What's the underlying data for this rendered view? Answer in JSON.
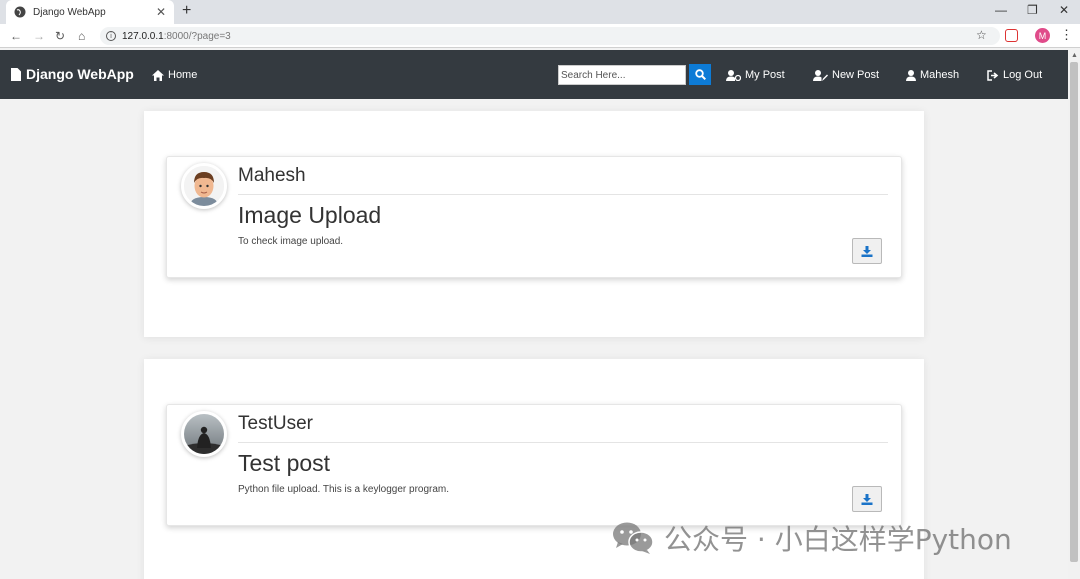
{
  "browser": {
    "tab_title": "Django WebApp",
    "url_host": "127.0.0.1",
    "url_path": ":8000/?page=3",
    "profile_initial": "M"
  },
  "navbar": {
    "brand": "Django WebApp",
    "home": "Home",
    "search_placeholder": "Search Here...",
    "my_post": "My Post",
    "new_post": "New Post",
    "user": "Mahesh",
    "logout": "Log Out"
  },
  "posts": [
    {
      "author": "Mahesh",
      "title": "Image Upload",
      "body": "To check image upload."
    },
    {
      "author": "TestUser",
      "title": "Test post",
      "body": "Python file upload. This is a keylogger program."
    }
  ],
  "watermark": "公众号 · 小白这样学Python",
  "colors": {
    "navbar": "#343a40",
    "accent": "#0d7bd6"
  }
}
